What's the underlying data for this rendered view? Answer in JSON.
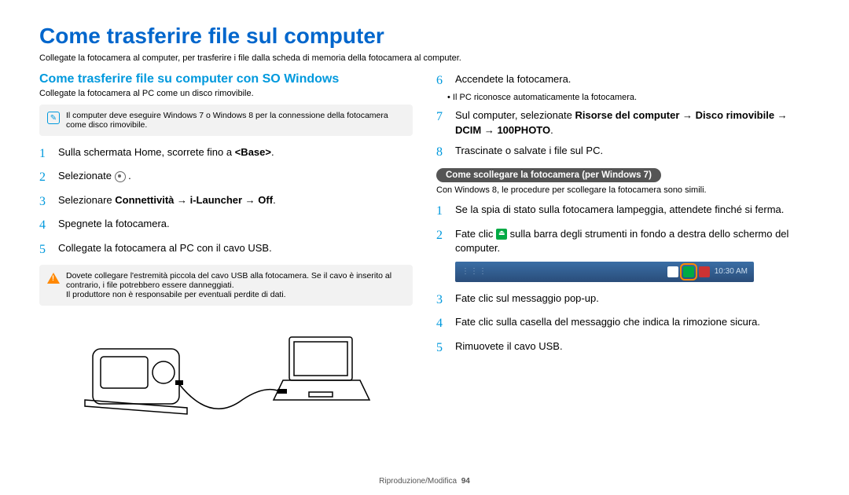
{
  "title": "Come trasferire file sul computer",
  "intro": "Collegate la fotocamera al computer, per trasferire i file dalla scheda di memoria della fotocamera al computer.",
  "left": {
    "heading": "Come trasferire file su computer con SO Windows",
    "sub": "Collegate la fotocamera al PC come un disco rimovibile.",
    "note": "Il computer deve eseguire Windows 7 o Windows 8 per la connessione della fotocamera come disco rimovibile.",
    "steps": [
      {
        "n": "1",
        "prefix": "Sulla schermata Home, scorrete fino a ",
        "bold": "<Base>",
        "suffix": "."
      },
      {
        "n": "2",
        "prefix": "Selezionate ",
        "icon": "circle",
        "suffix": " ."
      },
      {
        "n": "3",
        "prefix": "Selezionare ",
        "bold": "Connettività → i-Launcher → Off",
        "suffix": "."
      },
      {
        "n": "4",
        "prefix": "Spegnete la fotocamera."
      },
      {
        "n": "5",
        "prefix": "Collegate la fotocamera al PC con il cavo USB."
      }
    ],
    "warn_l1": "Dovete collegare l'estremità piccola del cavo USB alla fotocamera. Se il cavo è inserito al contrario, i file potrebbero essere danneggiati.",
    "warn_l2": "Il produttore non è responsabile per eventuali perdite di dati."
  },
  "right": {
    "steps_top": [
      {
        "n": "6",
        "prefix": "Accendete la fotocamera.",
        "sub": "Il PC riconosce automaticamente la fotocamera."
      },
      {
        "n": "7",
        "prefix": "Sul computer, selezionate ",
        "bold": "Risorse del computer → Disco rimovibile → DCIM → 100PHOTO",
        "suffix": "."
      },
      {
        "n": "8",
        "prefix": "Trascinate o salvate i file sul PC."
      }
    ],
    "pill": "Come scollegare la fotocamera (per Windows 7)",
    "pill_sub": "Con Windows 8, le procedure per scollegare la fotocamera sono simili.",
    "steps_bot": [
      {
        "n": "1",
        "prefix": "Se la spia di stato sulla fotocamera lampeggia, attendete finché si ferma."
      },
      {
        "n": "2",
        "prefix": "Fate clic ",
        "icon": "green",
        "suffix": " sulla barra degli strumenti in fondo a destra dello schermo del computer."
      },
      {
        "n": "3",
        "prefix": "Fate clic sul messaggio pop-up."
      },
      {
        "n": "4",
        "prefix": "Fate clic sulla casella del messaggio che indica la rimozione sicura."
      },
      {
        "n": "5",
        "prefix": "Rimuovete il cavo USB."
      }
    ],
    "taskbar_time": "10:30  AM"
  },
  "footer_section": "Riproduzione/Modifica",
  "footer_page": "94"
}
